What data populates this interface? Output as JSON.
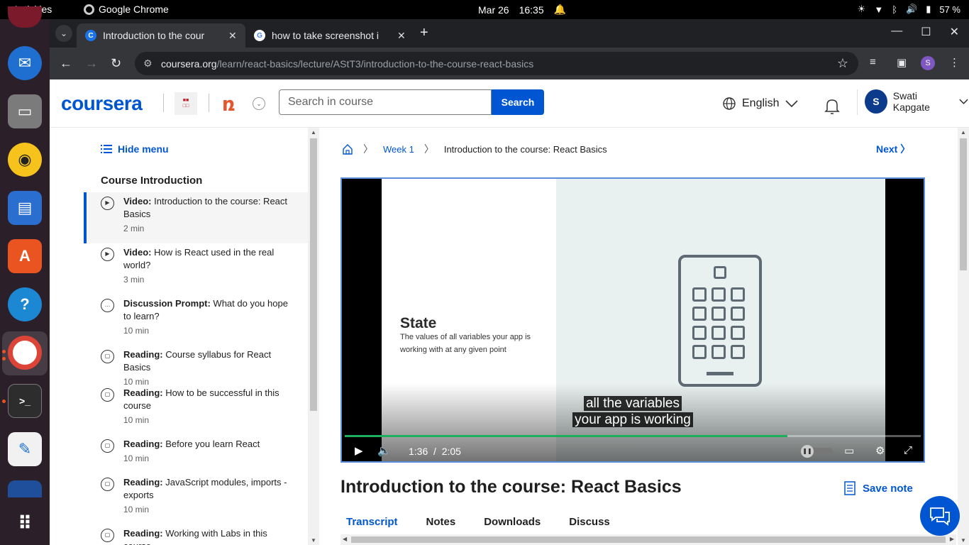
{
  "system": {
    "activities": "Activities",
    "app_name": "Google Chrome",
    "date": "Mar 26",
    "time": "16:35",
    "battery": "57 %"
  },
  "browser": {
    "tabs": [
      {
        "title": "Introduction to the cour",
        "favicon": "C",
        "active": true
      },
      {
        "title": "how to take screenshot i",
        "favicon": "G",
        "active": false
      }
    ],
    "url_host": "coursera.org",
    "url_path": "/learn/react-basics/lecture/AStT3/introduction-to-the-course-react-basics",
    "profile_initial": "S"
  },
  "header": {
    "logo": "coursera",
    "search_placeholder": "Search in course",
    "search_button": "Search",
    "language": "English",
    "user_initial": "S",
    "user_name": "Swati Kapgate"
  },
  "sidebar": {
    "hide_menu": "Hide menu",
    "section_title": "Course Introduction",
    "items": [
      {
        "type": "Video:",
        "title": "Introduction to the course: React Basics",
        "duration": "2 min",
        "icon": "play-icon",
        "active": true
      },
      {
        "type": "Video:",
        "title": "How is React used in the real world?",
        "duration": "3 min",
        "icon": "play-icon",
        "active": false
      },
      {
        "type": "Discussion Prompt:",
        "title": "What do you hope to learn?",
        "duration": "10 min",
        "icon": "discussion-icon",
        "active": false
      },
      {
        "type": "Reading:",
        "title": "Course syllabus for React Basics",
        "duration": "10 min",
        "icon": "reading-icon",
        "active": false
      },
      {
        "type": "Reading:",
        "title": "How to be successful in this course",
        "duration": "10 min",
        "icon": "reading-icon",
        "active": false
      },
      {
        "type": "Reading:",
        "title": "Before you learn React",
        "duration": "10 min",
        "icon": "reading-icon",
        "active": false
      },
      {
        "type": "Reading:",
        "title": "JavaScript modules, imports - exports",
        "duration": "10 min",
        "icon": "reading-icon",
        "active": false
      },
      {
        "type": "Reading:",
        "title": "Working with Labs in this course",
        "duration": "",
        "icon": "reading-icon",
        "active": false
      }
    ]
  },
  "breadcrumb": {
    "week": "Week 1",
    "current": "Introduction to the course: React Basics",
    "next": "Next"
  },
  "video": {
    "slide_title": "State",
    "slide_desc": "The values of all variables your app is working with at any given point",
    "caption_line1": "all the variables",
    "caption_line2": "your app is working",
    "current_time": "1:36",
    "separator": "/",
    "duration": "2:05",
    "progress": 0.768
  },
  "lecture": {
    "title": "Introduction to the course: React Basics",
    "save_note": "Save note",
    "tabs": [
      "Transcript",
      "Notes",
      "Downloads",
      "Discuss"
    ]
  },
  "colors": {
    "brand": "#0056d2",
    "progress": "#1fae5b"
  }
}
